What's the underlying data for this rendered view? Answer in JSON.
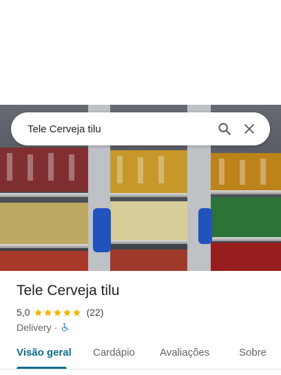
{
  "search": {
    "query": "Tele Cerveja tilu"
  },
  "icons": {
    "search": "search-icon",
    "close": "close-icon",
    "accessibility": "wheelchair-icon",
    "star": "star-icon"
  },
  "place": {
    "name": "Tele Cerveja tilu",
    "rating": "5,0",
    "stars": 5,
    "review_count": "(22)",
    "category": "Delivery",
    "separator": "·"
  },
  "tabs": [
    {
      "label": "Visão geral",
      "active": true
    },
    {
      "label": "Cardápio",
      "active": false
    },
    {
      "label": "Avaliações",
      "active": false
    },
    {
      "label": "Sobre",
      "active": false
    }
  ],
  "colors": {
    "accent": "#0b6b8a",
    "star": "#f4b400",
    "accessibility": "#1a73e8"
  }
}
